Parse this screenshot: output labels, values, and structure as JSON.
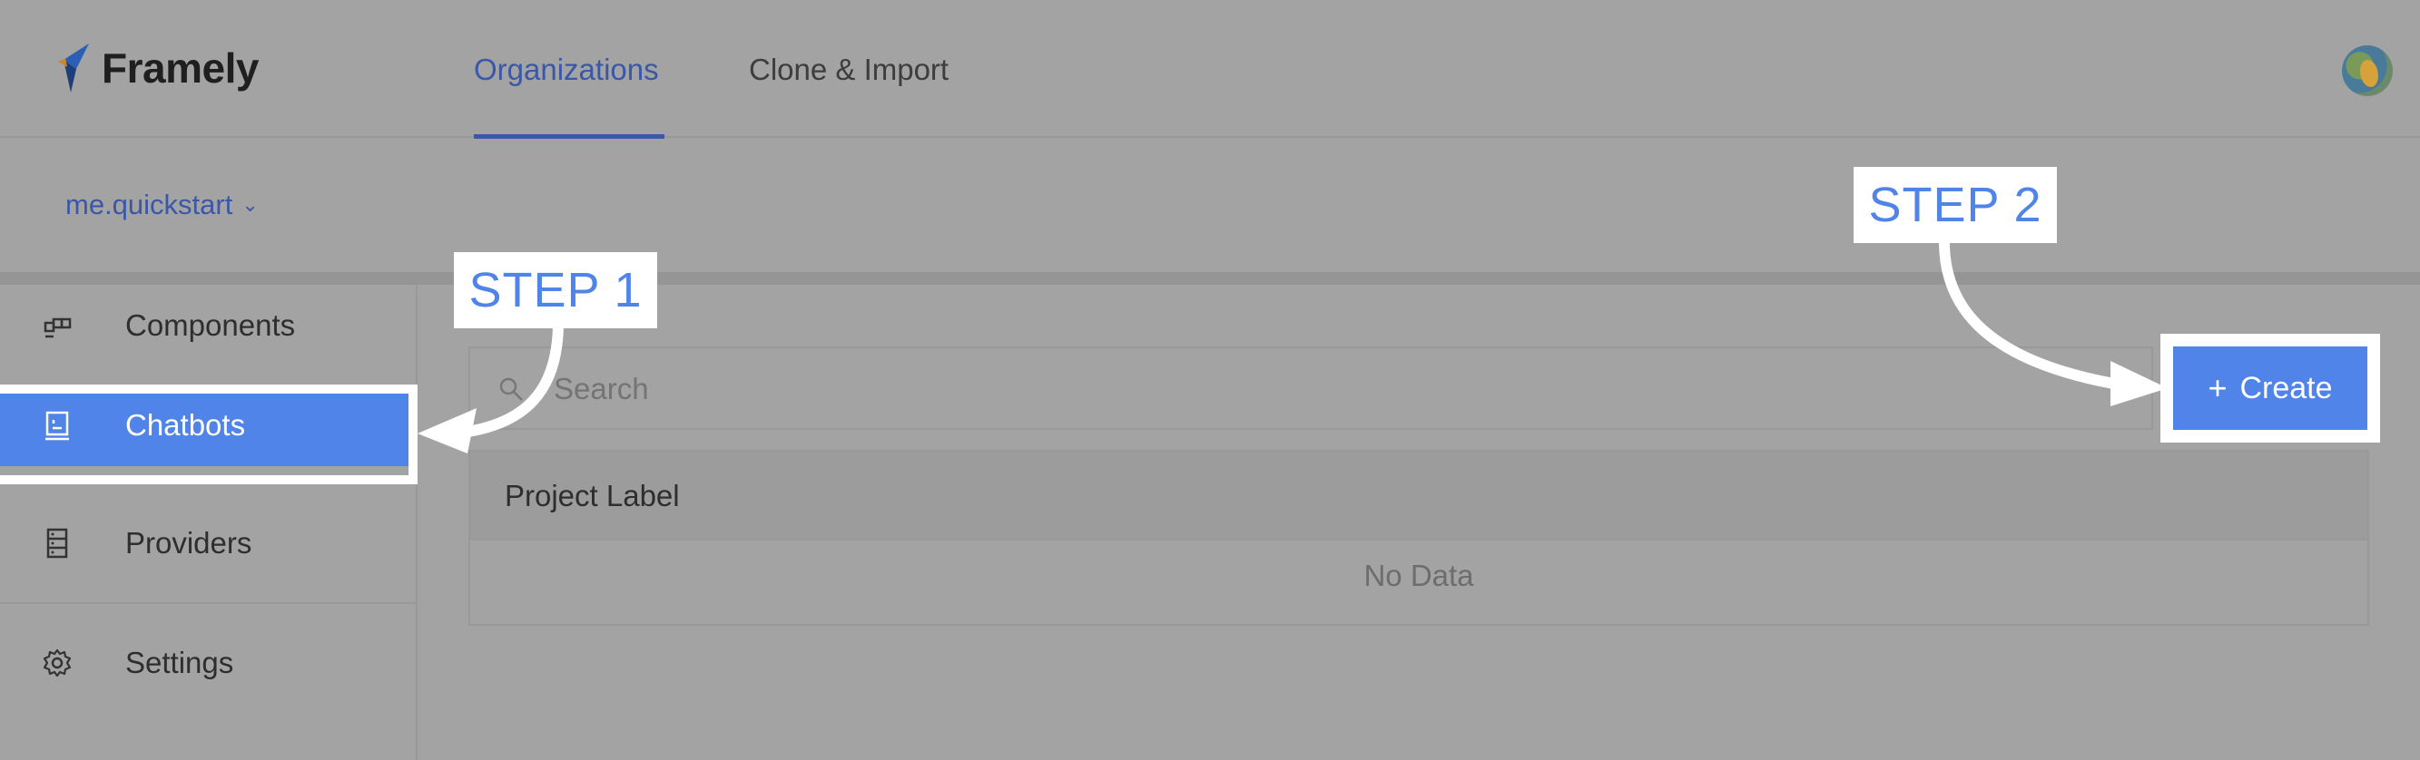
{
  "app": {
    "brand": "Framely"
  },
  "header": {
    "tabs": [
      {
        "label": "Organizations",
        "active": true
      },
      {
        "label": "Clone & Import",
        "active": false
      }
    ]
  },
  "org": {
    "name": "me.quickstart"
  },
  "sidebar": {
    "items": [
      {
        "label": "Components",
        "icon": "components-icon"
      },
      {
        "label": "Chatbots",
        "icon": "chatbot-icon",
        "active": true
      },
      {
        "label": "Providers",
        "icon": "providers-icon"
      },
      {
        "label": "Settings",
        "icon": "gear-icon"
      }
    ]
  },
  "search": {
    "placeholder": "Search"
  },
  "create": {
    "label": "Create",
    "icon": "plus-icon"
  },
  "table": {
    "columns": [
      "Project Label"
    ],
    "empty_text": "No Data"
  },
  "annotations": {
    "step1": "STEP 1",
    "step2": "STEP 2"
  },
  "colors": {
    "accent": "#5084e8",
    "link": "#3a57a8",
    "overlay": "#a3a3a3"
  }
}
